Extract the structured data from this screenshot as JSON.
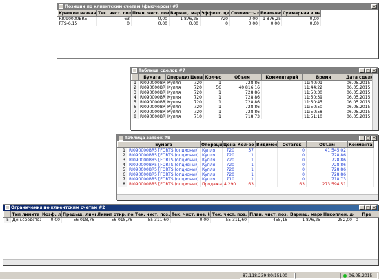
{
  "positions": {
    "title": "Позиции по клиентским счетам (фьючерсы) #7",
    "headers": [
      "Краткое назван",
      "Тек. чист. поз.",
      "План. чист. поз.",
      "Вариац. маржа",
      "Эффект. цена по",
      "Стоимость пози",
      "Реальная",
      "Суммарная в.мари"
    ],
    "rows": [
      [
        "RI090000BR5",
        "63",
        "0,00",
        "-1 876,25",
        "720",
        "0,00",
        "-1 876,25",
        "0,00"
      ],
      [
        "RTS-6.15",
        "0",
        "0,00",
        "0,00",
        "0",
        "0,00",
        "0,00",
        "0,00"
      ]
    ]
  },
  "trades": {
    "title": "Таблица сделок #7",
    "headers": [
      "",
      "Бумага",
      "Операция",
      "Цена",
      "Кол-во",
      "Объем",
      "Комментарий",
      "Время",
      "Дата сделки"
    ],
    "rows": [
      [
        "1",
        "RI090000BR5",
        "Купля",
        "720",
        "1",
        "728,86",
        "",
        "11:40:01",
        "06.05.2015"
      ],
      [
        "2",
        "RI090000BR5",
        "Купля",
        "720",
        "56",
        "40 816,16",
        "",
        "11:44:22",
        "06.05.2015"
      ],
      [
        "3",
        "RI090000BR5",
        "Купля",
        "720",
        "1",
        "728,86",
        "",
        "11:50:30",
        "06.05.2015"
      ],
      [
        "4",
        "RI090000BR5",
        "Купля",
        "720",
        "1",
        "728,86",
        "",
        "11:50:39",
        "06.05.2015"
      ],
      [
        "5",
        "RI090000BR5",
        "Купля",
        "720",
        "1",
        "728,86",
        "",
        "11:50:45",
        "06.05.2015"
      ],
      [
        "6",
        "RI090000BR5",
        "Купля",
        "720",
        "1",
        "728,86",
        "",
        "11:50:50",
        "06.05.2015"
      ],
      [
        "7",
        "RI090000BR5",
        "Купля",
        "720",
        "1",
        "728,86",
        "",
        "11:50:58",
        "06.05.2015"
      ],
      [
        "8",
        "RI090000BR5",
        "Купля",
        "710",
        "1",
        "718,73",
        "",
        "11:51:10",
        "06.05.2015"
      ]
    ]
  },
  "orders": {
    "title": "Таблица заявок #9",
    "headers": [
      "",
      "Бумага",
      "Операция",
      "Цена",
      "Кол-во",
      "Видимое",
      "Остаток",
      "Объем",
      "Комментарий"
    ],
    "rows": [
      {
        "style": "blue",
        "cells": [
          "1",
          "RI090000BR5 [FORTS (опционы)]",
          "Купля",
          "720",
          "57",
          "",
          "0",
          "41 545,02",
          ""
        ]
      },
      {
        "style": "blue",
        "cells": [
          "2",
          "RI090000BR5 [FORTS (опционы)]",
          "Купля",
          "720",
          "1",
          "",
          "0",
          "728,86",
          ""
        ]
      },
      {
        "style": "blue",
        "cells": [
          "3",
          "RI090000BR5 [FORTS (опционы)]",
          "Купля",
          "720",
          "1",
          "",
          "0",
          "728,86",
          ""
        ]
      },
      {
        "style": "blue",
        "cells": [
          "4",
          "RI090000BR5 [FORTS (опционы)]",
          "Купля",
          "720",
          "1",
          "",
          "0",
          "728,86",
          ""
        ]
      },
      {
        "style": "blue",
        "cells": [
          "5",
          "RI090000BR5 [FORTS (опционы)]",
          "Купля",
          "720",
          "1",
          "",
          "0",
          "728,86",
          ""
        ]
      },
      {
        "style": "blue",
        "cells": [
          "6",
          "RI090000BR5 [FORTS (опционы)]",
          "Купля",
          "720",
          "1",
          "",
          "0",
          "728,86",
          ""
        ]
      },
      {
        "style": "blue",
        "cells": [
          "7",
          "RI090000BR5 [FORTS (опционы)]",
          "Купля",
          "710",
          "1",
          "",
          "0",
          "718,73",
          ""
        ]
      },
      {
        "style": "red",
        "cells": [
          "8",
          "RI090000BR5 [FORTS (опционы)]",
          "Продажа",
          "4 290",
          "63",
          "",
          "63",
          "273 594,51",
          ""
        ]
      }
    ]
  },
  "limits": {
    "title": "Ограничения по клиентским счетам #2",
    "headers": [
      "",
      "Тип лимита",
      "Коэф. лик",
      "Предыд. лимит о",
      "Лимит откр. поз.",
      "Тек. чист. поз.",
      "Тек. чист. поз. (п",
      "Тек. чист. поз.",
      "План. чист. поз.",
      "Вариац. маржа",
      "Накоплен. доход",
      "Пре"
    ],
    "rows": [
      [
        "5",
        "Ден.средства",
        "0,00",
        "56 018,76",
        "56 018,76",
        "55 311,60",
        "0,00",
        "55 311,60",
        "455,16",
        "-1 876,25",
        "-252,00",
        "0"
      ]
    ]
  },
  "statusbar": {
    "address": "87.118.239.80:15100",
    "date": "06.05.2015"
  },
  "colors": {
    "title_active": "#0a246a",
    "buy_text": "#1f3fd6",
    "sell_text": "#d01818",
    "connection_ok": "#17b81d"
  }
}
